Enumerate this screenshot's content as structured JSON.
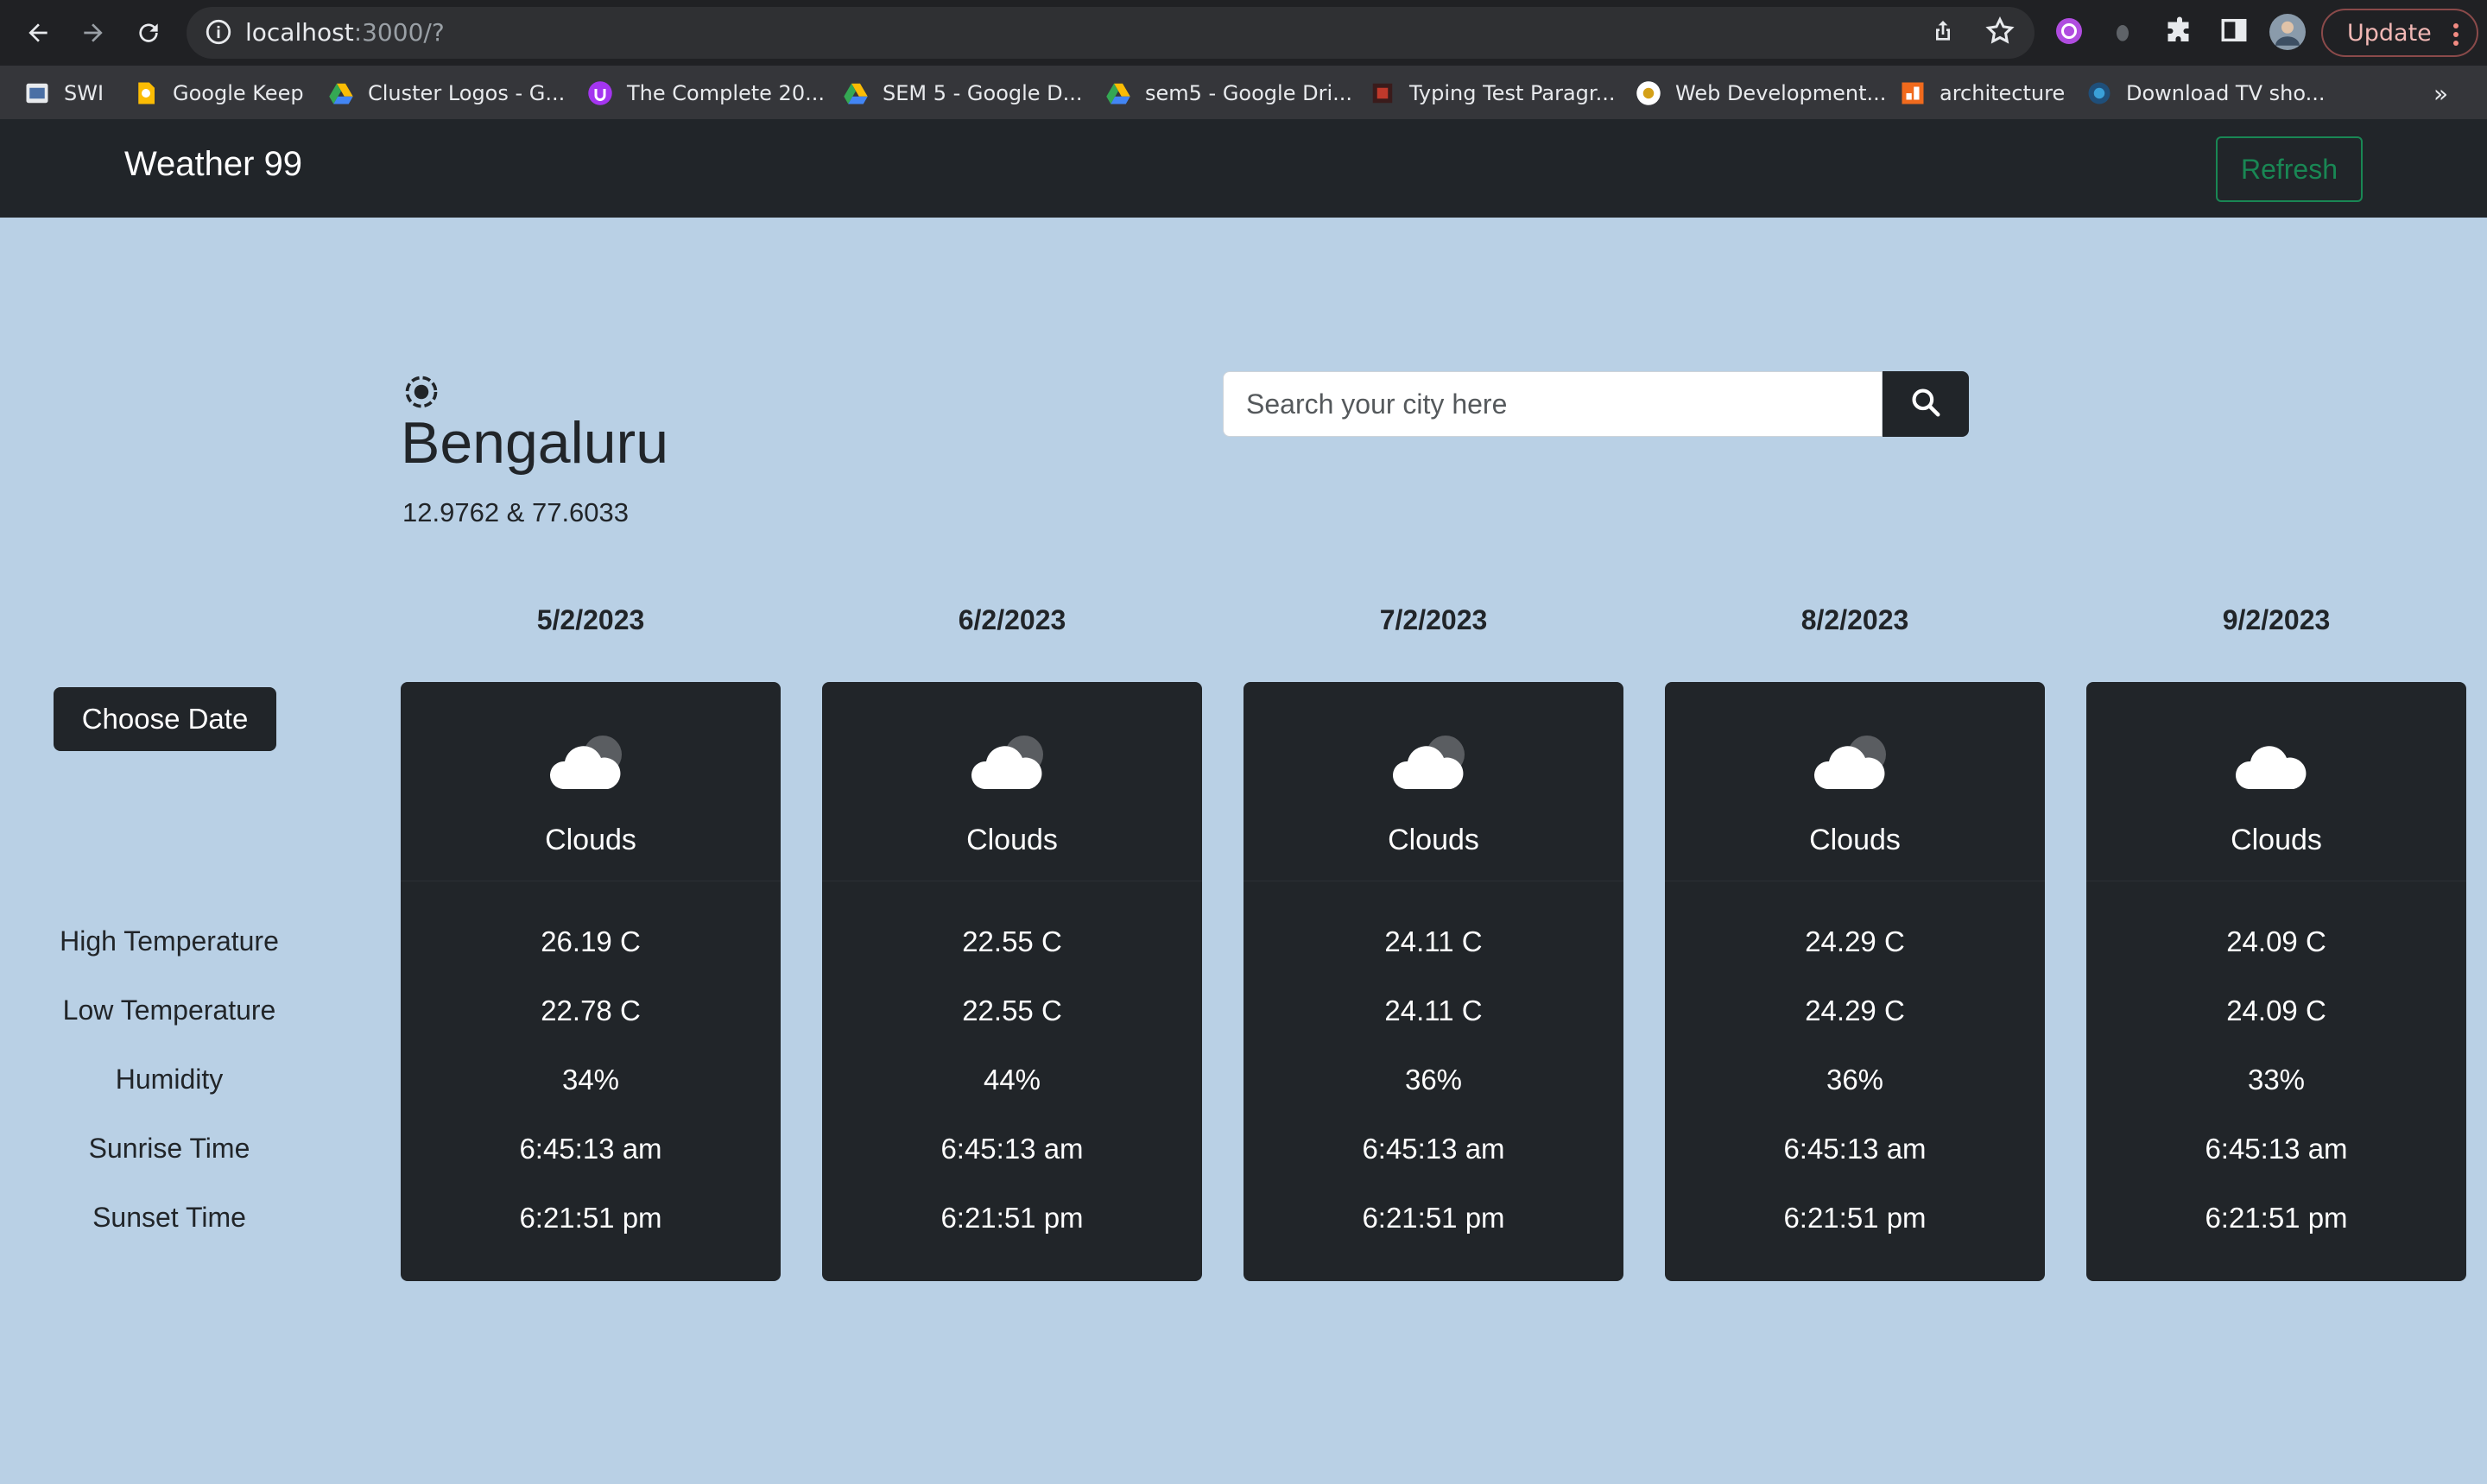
{
  "browser": {
    "url_host": "localhost",
    "url_rest": ":3000/?",
    "update_label": "Update",
    "bookmarks": [
      {
        "label": "SWI",
        "icon": "swi-favicon"
      },
      {
        "label": "Google Keep",
        "icon": "google-keep-favicon"
      },
      {
        "label": "Cluster Logos - G...",
        "icon": "google-drive-favicon"
      },
      {
        "label": "The Complete 20...",
        "icon": "udemy-favicon"
      },
      {
        "label": "SEM 5 - Google D...",
        "icon": "google-drive-favicon"
      },
      {
        "label": "sem5 - Google Dri...",
        "icon": "google-drive-favicon"
      },
      {
        "label": "Typing Test Paragr...",
        "icon": "typing-test-favicon"
      },
      {
        "label": "Web Development...",
        "icon": "web-dev-favicon"
      },
      {
        "label": "architecture",
        "icon": "architecture-favicon"
      },
      {
        "label": "Download TV sho...",
        "icon": "tv-favicon"
      }
    ],
    "more_label": "»"
  },
  "navbar": {
    "brand": "Weather 99",
    "refresh_label": "Refresh"
  },
  "location": {
    "city": "Bengaluru",
    "coords": "12.9762 & 77.6033"
  },
  "search": {
    "placeholder": "Search your city here",
    "value": ""
  },
  "sidebar": {
    "choose_date_label": "Choose Date",
    "row_labels": [
      "High Temperature",
      "Low Temperature",
      "Humidity",
      "Sunrise Time",
      "Sunset Time"
    ]
  },
  "days": [
    {
      "date": "5/2/2023",
      "condition": "Clouds",
      "icon": "broken-clouds-icon",
      "high": "26.19 C",
      "low": "22.78 C",
      "humidity": "34%",
      "sunrise": "6:45:13 am",
      "sunset": "6:21:51 pm"
    },
    {
      "date": "6/2/2023",
      "condition": "Clouds",
      "icon": "broken-clouds-icon",
      "high": "22.55 C",
      "low": "22.55 C",
      "humidity": "44%",
      "sunrise": "6:45:13 am",
      "sunset": "6:21:51 pm"
    },
    {
      "date": "7/2/2023",
      "condition": "Clouds",
      "icon": "broken-clouds-icon",
      "high": "24.11 C",
      "low": "24.11 C",
      "humidity": "36%",
      "sunrise": "6:45:13 am",
      "sunset": "6:21:51 pm"
    },
    {
      "date": "8/2/2023",
      "condition": "Clouds",
      "icon": "broken-clouds-icon",
      "high": "24.29 C",
      "low": "24.29 C",
      "humidity": "36%",
      "sunrise": "6:45:13 am",
      "sunset": "6:21:51 pm"
    },
    {
      "date": "9/2/2023",
      "condition": "Clouds",
      "icon": "scattered-clouds-icon",
      "high": "24.09 C",
      "low": "24.09 C",
      "humidity": "33%",
      "sunrise": "6:45:13 am",
      "sunset": "6:21:51 pm"
    }
  ],
  "colors": {
    "page_bg": "#b9d0e5",
    "dark": "#212529",
    "refresh_accent": "#198754"
  }
}
